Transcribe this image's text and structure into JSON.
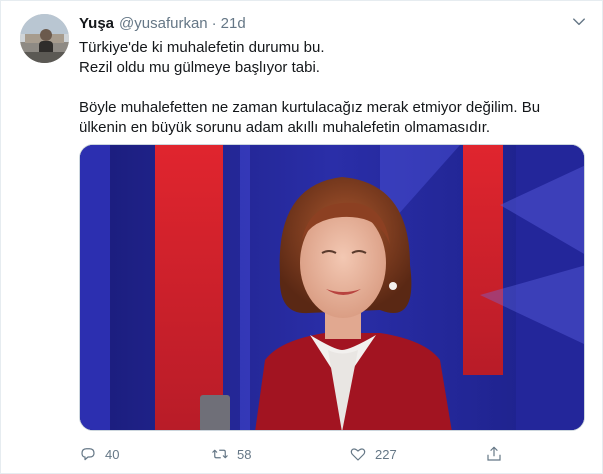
{
  "tweet": {
    "author_name": "Yuşa",
    "handle": "@yusafurkan",
    "separator": "·",
    "time": "21d",
    "lines": [
      "Türkiye'de ki muhalefetin durumu bu.",
      "Rezil oldu mu gülmeye başlıyor tabi.",
      "",
      "Böyle muhalefetten ne zaman kurtulacağız merak etmiyor değilim. Bu",
      "ülkenin en büyük sorunu adam akıllı muhalefetin olmamasıdır."
    ],
    "media_kind": "video-thumbnail"
  },
  "actions": {
    "reply_count": "40",
    "retweet_count": "58",
    "like_count": "227"
  },
  "icons": {
    "reply": "reply-icon",
    "retweet": "retweet-icon",
    "like": "heart-icon",
    "share": "share-icon",
    "more": "chevron-down-icon"
  },
  "colors": {
    "text": "#14171a",
    "secondary": "#657786",
    "border": "#e6ecf0",
    "media_blue": "#1b1f86",
    "media_red": "#e2262b"
  }
}
